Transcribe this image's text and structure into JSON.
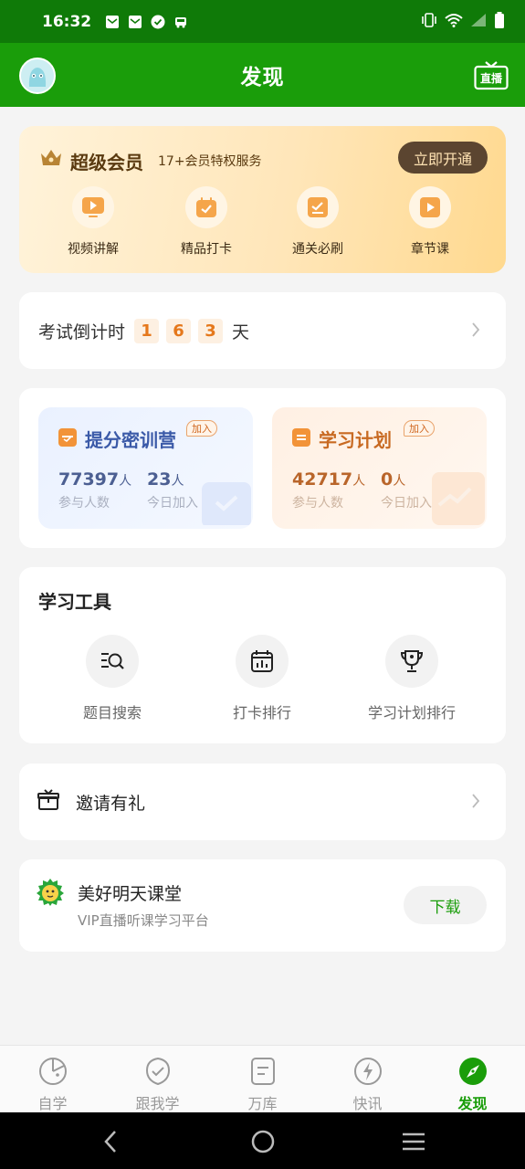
{
  "status_bar": {
    "time": "16:32",
    "left_icons": [
      "mail-icon",
      "mail-icon",
      "check-circle-icon",
      "car-icon"
    ],
    "right_icons": [
      "vibrate-icon",
      "wifi-icon",
      "signal-icon",
      "battery-icon"
    ]
  },
  "header": {
    "title": "发现",
    "live_label": "直播",
    "accent_color": "#1a9d0a"
  },
  "vip": {
    "title": "超级会员",
    "subtitle": "17+会员特权服务",
    "cta": "立即开通",
    "items": [
      {
        "label": "视频讲解",
        "icon": "video-play-icon"
      },
      {
        "label": "精品打卡",
        "icon": "calendar-check-icon"
      },
      {
        "label": "通关必刷",
        "icon": "checklist-icon"
      },
      {
        "label": "章节课",
        "icon": "course-play-icon"
      }
    ]
  },
  "countdown": {
    "label": "考试倒计时",
    "digits": [
      "1",
      "6",
      "3"
    ],
    "unit": "天"
  },
  "camps": [
    {
      "title": "提分密训营",
      "badge": "加入",
      "stats": [
        {
          "num": "77397",
          "unit": "人",
          "caption": "参与人数"
        },
        {
          "num": "23",
          "unit": "人",
          "caption": "今日加入"
        }
      ]
    },
    {
      "title": "学习计划",
      "badge": "加入",
      "stats": [
        {
          "num": "42717",
          "unit": "人",
          "caption": "参与人数"
        },
        {
          "num": "0",
          "unit": "人",
          "caption": "今日加入"
        }
      ]
    }
  ],
  "tools": {
    "title": "学习工具",
    "items": [
      {
        "label": "题目搜索",
        "icon": "search-list-icon"
      },
      {
        "label": "打卡排行",
        "icon": "calendar-chart-icon"
      },
      {
        "label": "学习计划排行",
        "icon": "trophy-icon"
      }
    ]
  },
  "invite": {
    "label": "邀请有礼",
    "icon": "gift-icon"
  },
  "app_promo": {
    "name": "美好明天课堂",
    "desc": "VIP直播听课学习平台",
    "button": "下载"
  },
  "tabs": [
    {
      "label": "自学",
      "icon": "pie-icon",
      "active": false
    },
    {
      "label": "跟我学",
      "icon": "shield-check-icon",
      "active": false
    },
    {
      "label": "万库",
      "icon": "document-icon",
      "active": false
    },
    {
      "label": "快讯",
      "icon": "bolt-icon",
      "active": false
    },
    {
      "label": "发现",
      "icon": "compass-icon",
      "active": true
    }
  ]
}
